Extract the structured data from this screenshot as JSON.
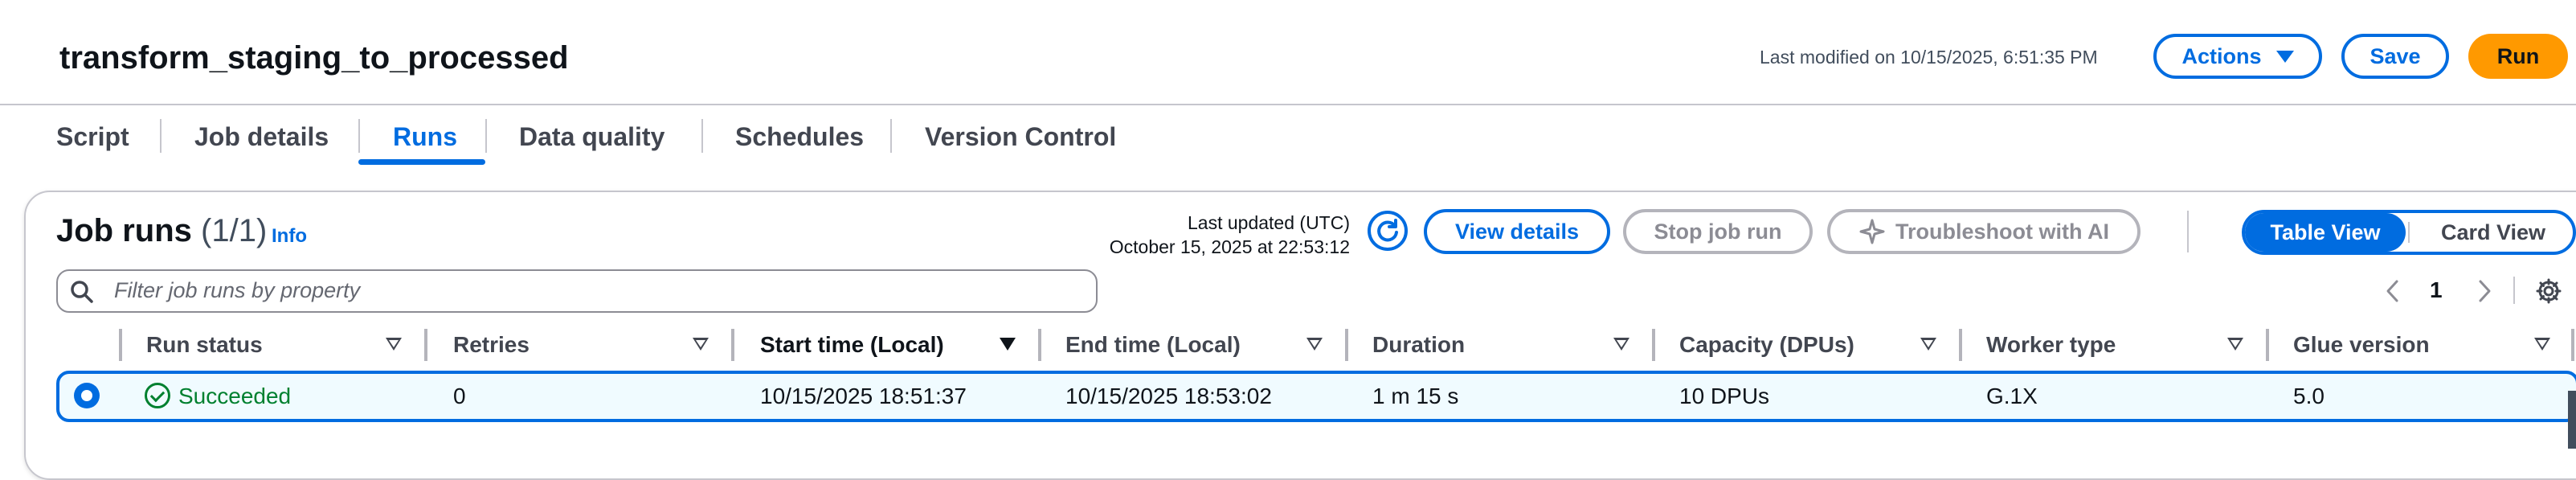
{
  "header": {
    "title": "transform_staging_to_processed",
    "last_modified": "Last modified on 10/15/2025, 6:51:35 PM",
    "actions_label": "Actions",
    "save_label": "Save",
    "run_label": "Run"
  },
  "tabs": [
    {
      "label": "Script"
    },
    {
      "label": "Job details"
    },
    {
      "label": "Runs"
    },
    {
      "label": "Data quality"
    },
    {
      "label": "Schedules"
    },
    {
      "label": "Version Control"
    }
  ],
  "active_tab": "Runs",
  "job_runs": {
    "title": "Job runs",
    "count": "(1/1)",
    "info_label": "Info",
    "updated_label": "Last updated (UTC)",
    "updated_time": "October 15, 2025 at 22:53:12",
    "view_details_label": "View details",
    "stop_label": "Stop job run",
    "troubleshoot_label": "Troubleshoot with AI",
    "view_toggle": {
      "table": "Table View",
      "card": "Card View",
      "selected": "Table View"
    },
    "search_placeholder": "Filter job runs by property",
    "page": "1"
  },
  "table": {
    "columns": [
      "Run status",
      "Retries",
      "Start time (Local)",
      "End time (Local)",
      "Duration",
      "Capacity (DPUs)",
      "Worker type",
      "Glue version"
    ],
    "sorted_column": "Start time (Local)",
    "rows": [
      {
        "selected": true,
        "status": "Succeeded",
        "retries": "0",
        "start": "10/15/2025 18:51:37",
        "end": "10/15/2025 18:53:02",
        "duration": "1 m 15 s",
        "capacity": "10 DPUs",
        "worker": "G.1X",
        "glue": "5.0"
      }
    ]
  },
  "colors": {
    "accent": "#006ce0",
    "primary_button": "#ff9900",
    "success": "#00802f"
  }
}
